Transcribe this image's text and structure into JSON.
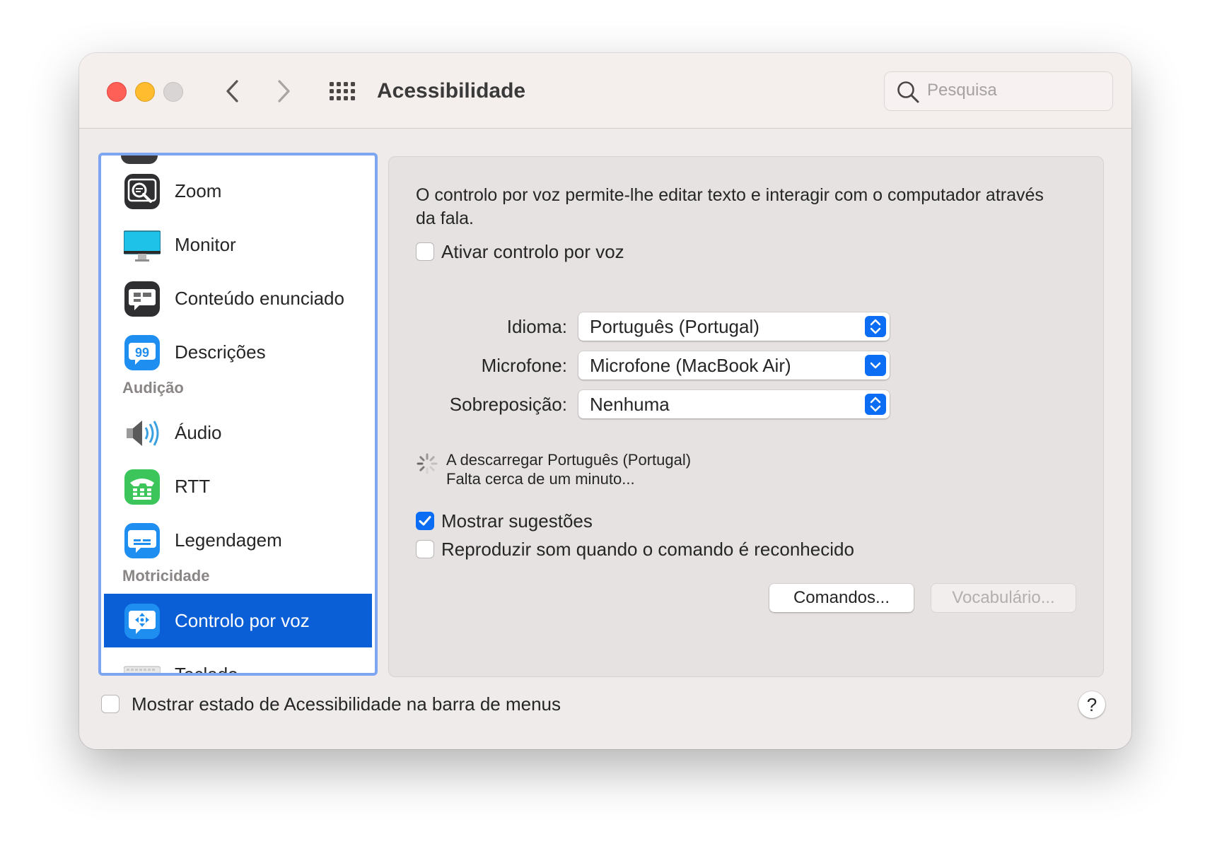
{
  "window": {
    "title": "Acessibilidade",
    "search_placeholder": "Pesquisa"
  },
  "sidebar": {
    "items": [
      {
        "label": "Zoom",
        "icon": "zoom-magnifier-icon"
      },
      {
        "label": "Monitor",
        "icon": "display-monitor-icon"
      },
      {
        "label": "Conteúdo enunciado",
        "icon": "speech-bubble-icon"
      },
      {
        "label": "Descrições",
        "icon": "quote-bubble-icon"
      },
      {
        "label": "Áudio",
        "icon": "speaker-icon"
      },
      {
        "label": "RTT",
        "icon": "telephone-keypad-icon"
      },
      {
        "label": "Legendagem",
        "icon": "captions-bubble-icon"
      },
      {
        "label": "Controlo por voz",
        "icon": "voice-control-icon",
        "selected": true
      },
      {
        "label": "Teclado",
        "icon": "keyboard-icon"
      }
    ],
    "headers": {
      "hearing": "Audição",
      "motor": "Motricidade"
    }
  },
  "main": {
    "description": "O controlo por voz permite-lhe editar texto e interagir com o computador através da fala.",
    "enable_voice_control": {
      "label": "Ativar controlo por voz",
      "checked": false
    },
    "language": {
      "label": "Idioma:",
      "value": "Português (Portugal)"
    },
    "microphone": {
      "label": "Microfone:",
      "value": "Microfone (MacBook Air)"
    },
    "overlay": {
      "label": "Sobreposição:",
      "value": "Nenhuma"
    },
    "download": {
      "line1": "A descarregar Português (Portugal)",
      "line2": "Falta cerca de um minuto..."
    },
    "show_hints": {
      "label": "Mostrar sugestões",
      "checked": true
    },
    "play_sound": {
      "label": "Reproduzir som quando o comando é reconhecido",
      "checked": false
    },
    "commands_button": "Comandos...",
    "vocabulary_button": "Vocabulário..."
  },
  "footer": {
    "show_status": {
      "label": "Mostrar estado de Acessibilidade na barra de menus",
      "checked": false
    },
    "help": "?"
  },
  "colors": {
    "accent": "#0a6df3",
    "selection": "#0a5fd7",
    "sidebar_focus_ring": "#7ea6f0"
  }
}
